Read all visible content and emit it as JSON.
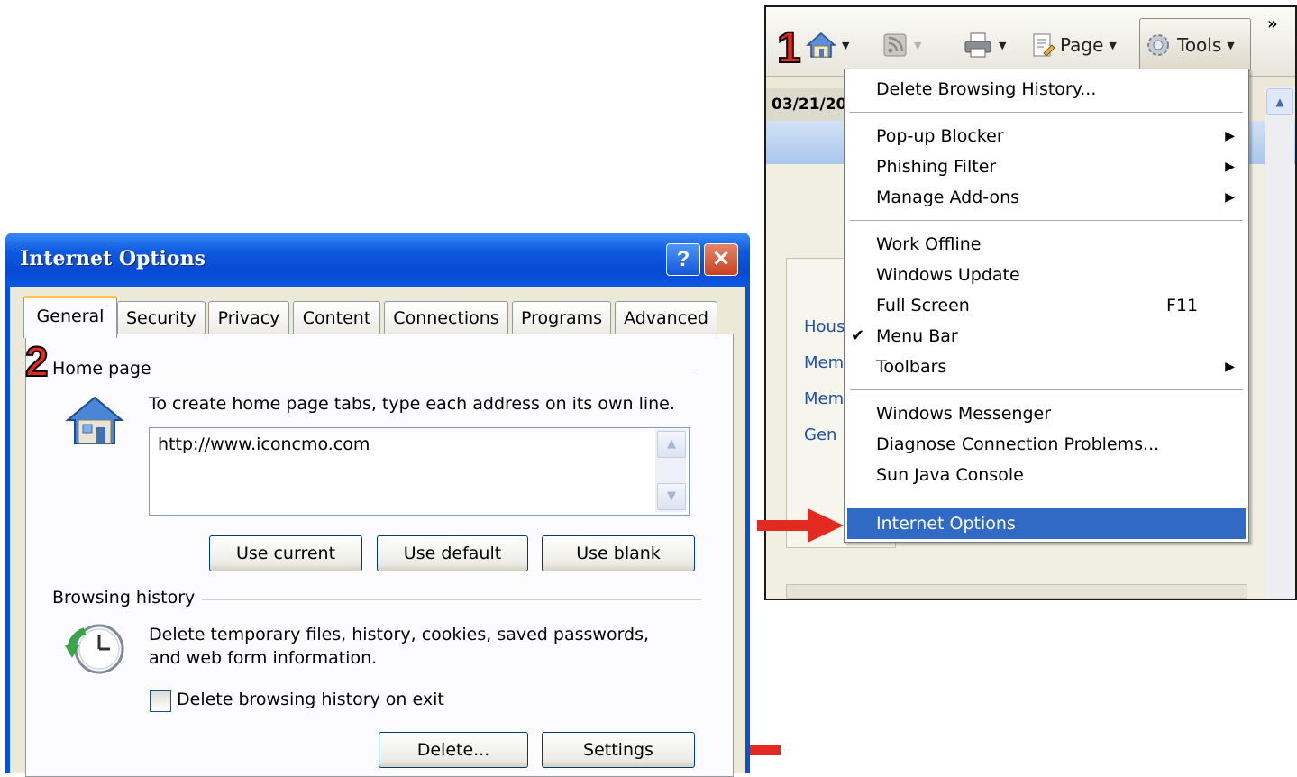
{
  "ie": {
    "step_number": "1",
    "toolbar": {
      "home_icon": "home-icon",
      "feeds_icon": "rss-feed-icon",
      "print_icon": "printer-icon",
      "page_label": "Page",
      "tools_label": "Tools",
      "chevron": "»"
    },
    "date_fragment": "03/21/20",
    "link_fragments": [
      "Hous",
      "Mem",
      "Mem",
      "Gen"
    ],
    "tools_menu": [
      {
        "label": "Delete Browsing History..."
      },
      {
        "label": "Pop-up Blocker",
        "submenu": true
      },
      {
        "label": "Phishing Filter",
        "submenu": true
      },
      {
        "label": "Manage Add-ons",
        "submenu": true
      },
      {
        "label": "Work Offline"
      },
      {
        "label": "Windows Update"
      },
      {
        "label": "Full Screen",
        "shortcut": "F11"
      },
      {
        "label": "Menu Bar",
        "checked": true
      },
      {
        "label": "Toolbars",
        "submenu": true
      },
      {
        "label": "Windows Messenger"
      },
      {
        "label": "Diagnose Connection Problems..."
      },
      {
        "label": "Sun Java Console"
      },
      {
        "label": "Internet Options",
        "selected": true
      }
    ],
    "check_mark": "✔",
    "submenu_arrow": "▶"
  },
  "dialog": {
    "title": "Internet Options",
    "help_label": "?",
    "close_label": "✕",
    "step_number": "2",
    "tabs": [
      "General",
      "Security",
      "Privacy",
      "Content",
      "Connections",
      "Programs",
      "Advanced"
    ],
    "active_tab": "General",
    "home_page": {
      "group_label": "Home page",
      "instructions": "To create home page tabs, type each address on its own line.",
      "value": "http://www.iconcmo.com",
      "buttons": [
        "Use current",
        "Use default",
        "Use blank"
      ]
    },
    "browsing_history": {
      "group_label": "Browsing history",
      "description_line1": "Delete temporary files, history, cookies, saved passwords,",
      "description_line2": "and web form information.",
      "checkbox_label": "Delete browsing history on exit",
      "checkbox_checked": false,
      "buttons": [
        "Delete...",
        "Settings"
      ]
    }
  },
  "colors": {
    "menu_highlight": "#316ac5",
    "annotation_red": "#e32a21",
    "xp_title_blue": "#0a57e2"
  }
}
